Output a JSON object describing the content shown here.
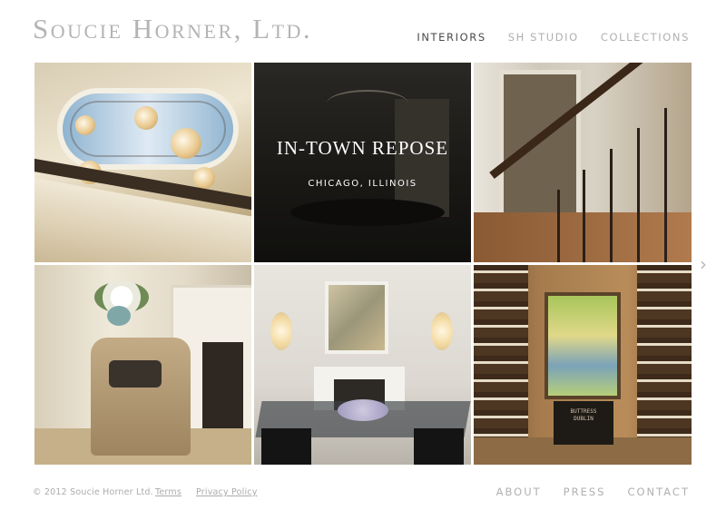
{
  "brand": {
    "logo_text": "Soucie Horner, Ltd."
  },
  "nav": {
    "items": [
      {
        "label": "INTERIORS",
        "active": true
      },
      {
        "label": "SH STUDIO",
        "active": false
      },
      {
        "label": "COLLECTIONS",
        "active": false
      }
    ]
  },
  "feature": {
    "title": "IN-TOWN REPOSE",
    "subtitle": "CHICAGO, ILLINOIS"
  },
  "tiles": {
    "cellar_stamp": "BUTTRESS\nDUBLIN"
  },
  "carousel": {
    "next_icon": "chevron-right-icon",
    "next_glyph": "›"
  },
  "footer": {
    "copyright": "© 2012 Soucie Horner Ltd.",
    "terms": "Terms",
    "privacy": "Privacy Policy",
    "links": [
      "ABOUT",
      "PRESS",
      "CONTACT"
    ]
  },
  "colors": {
    "nav_active": "#4a4a4a",
    "nav_inactive": "#b0b0b0",
    "logo": "#b4b4b4",
    "background": "#ffffff"
  }
}
